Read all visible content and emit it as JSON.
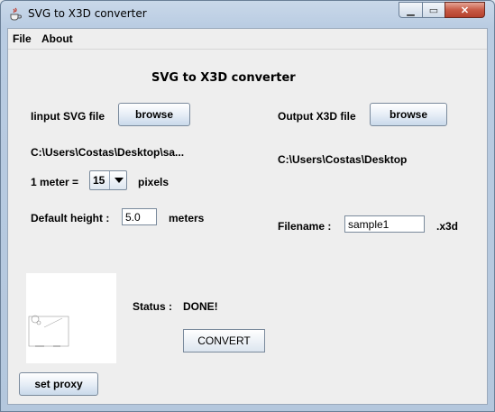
{
  "window": {
    "title": "SVG to X3D converter",
    "min_glyph": "▁",
    "max_glyph": "▭",
    "close_glyph": "✕"
  },
  "menu": {
    "file": "File",
    "about": "About"
  },
  "heading": "SVG to X3D converter",
  "input": {
    "label": "Iinput SVG file",
    "browse": "browse",
    "path": "C:\\Users\\Costas\\Desktop\\sa..."
  },
  "output": {
    "label": "Output X3D file",
    "browse": "browse",
    "path": "C:\\Users\\Costas\\Desktop"
  },
  "scale": {
    "label": "1 meter =",
    "value": "15",
    "unit": "pixels"
  },
  "height": {
    "label": "Default height :",
    "value": "5.0",
    "unit": "meters"
  },
  "filename": {
    "label": "Filename :",
    "value": "sample1",
    "ext": ".x3d"
  },
  "status": {
    "label": "Status :",
    "value": "DONE!"
  },
  "convert_label": "CONVERT",
  "proxy_label": "set proxy",
  "colors": {
    "titlebar": "#b9cce2",
    "panel": "#eeeeee",
    "close_button": "#c75a45"
  }
}
